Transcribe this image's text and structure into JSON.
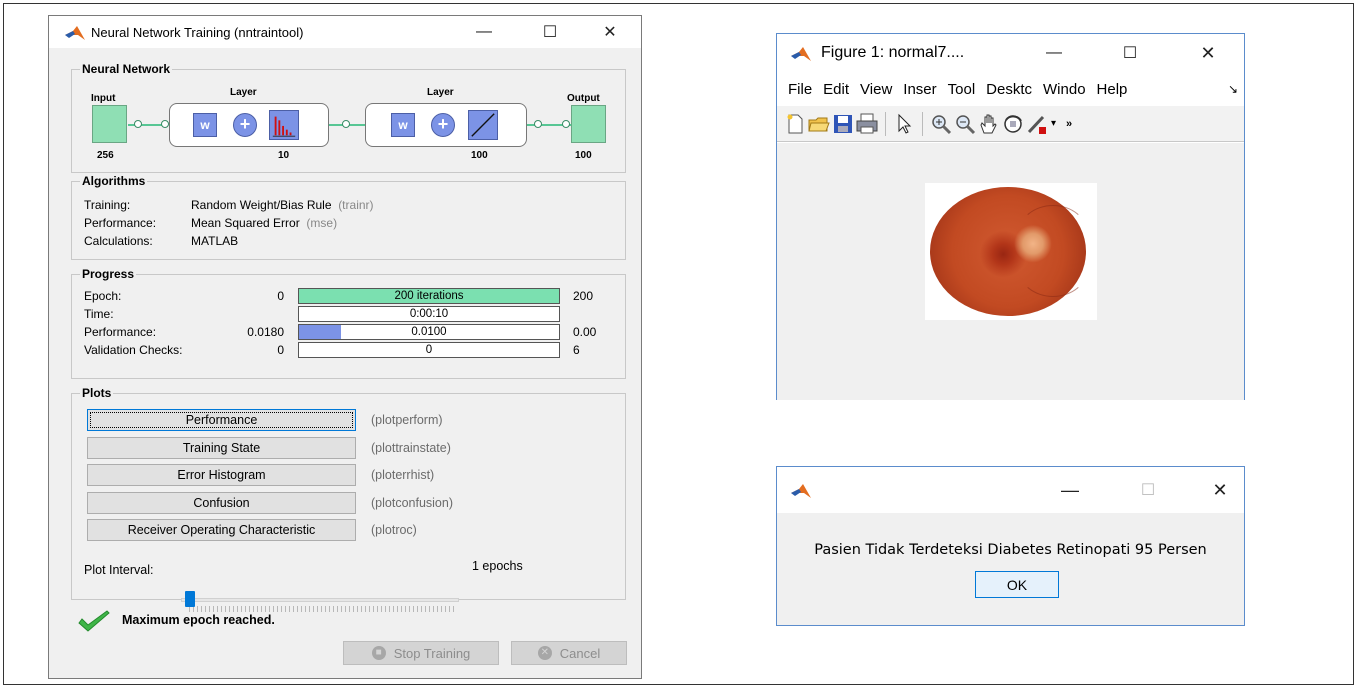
{
  "nntraintool": {
    "title": "Neural Network Training (nntraintool)",
    "network": {
      "section_title": "Neural Network",
      "input_label": "Input",
      "input_size": "256",
      "layer1_label": "Layer",
      "layer1_size": "10",
      "layer2_label": "Layer",
      "layer2_size": "100",
      "output_label": "Output",
      "output_size": "100",
      "w_label": "w"
    },
    "algorithms": {
      "section_title": "Algorithms",
      "rows": [
        {
          "label": "Training:",
          "value": "Random Weight/Bias Rule",
          "fn": "(trainr)"
        },
        {
          "label": "Performance:",
          "value": "Mean Squared Error",
          "fn": "(mse)"
        },
        {
          "label": "Calculations:",
          "value": "MATLAB",
          "fn": ""
        }
      ]
    },
    "progress": {
      "section_title": "Progress",
      "rows": [
        {
          "label": "Epoch:",
          "min": "0",
          "bar_text": "200 iterations",
          "max": "200",
          "fill": 1.0,
          "fill_color": "#7be0b0"
        },
        {
          "label": "Time:",
          "min": "",
          "bar_text": "0:00:10",
          "max": "",
          "fill": 0.0,
          "fill_color": "#7be0b0"
        },
        {
          "label": "Performance:",
          "min": "0.0180",
          "bar_text": "0.0100",
          "max": "0.00",
          "fill": 0.16,
          "fill_color": "#7c93e6"
        },
        {
          "label": "Validation Checks:",
          "min": "0",
          "bar_text": "0",
          "max": "6",
          "fill": 0.0,
          "fill_color": "#7be0b0"
        }
      ]
    },
    "plots": {
      "section_title": "Plots",
      "buttons": [
        {
          "label": "Performance",
          "fn": "(plotperform)"
        },
        {
          "label": "Training State",
          "fn": "(plottrainstate)"
        },
        {
          "label": "Error Histogram",
          "fn": "(ploterrhist)"
        },
        {
          "label": "Confusion",
          "fn": "(plotconfusion)"
        },
        {
          "label": "Receiver Operating Characteristic",
          "fn": "(plotroc)"
        }
      ],
      "interval_label": "Plot Interval:",
      "interval_value": "1 epochs",
      "interval_position": 0.0
    },
    "status_text": "Maximum epoch reached.",
    "stop_label": "Stop Training",
    "cancel_label": "Cancel"
  },
  "figure": {
    "title": "Figure 1: normal7....",
    "menu": [
      "File",
      "Edit",
      "View",
      "Insert",
      "Tools",
      "Desktop",
      "Window",
      "Help"
    ],
    "menu_display": [
      "File",
      "Edit",
      "View",
      "Inser",
      "Tool",
      "Desktc",
      "Windo",
      "Help"
    ],
    "toolbar_icons": [
      "new-figure-icon",
      "open-icon",
      "save-icon",
      "print-icon",
      "pointer-icon",
      "zoom-in-icon",
      "zoom-out-icon",
      "pan-icon",
      "rotate-icon",
      "brush-icon"
    ]
  },
  "dialog": {
    "message": "Pasien Tidak Terdeteksi Diabetes Retinopati 95 Persen",
    "ok_label": "OK"
  },
  "colors": {
    "matlab_orange": "#e36d20",
    "matlab_blue": "#2a5caa",
    "accent_blue": "#0078d7",
    "green_bar": "#7be0b0",
    "blue_bar": "#7c93e6"
  }
}
